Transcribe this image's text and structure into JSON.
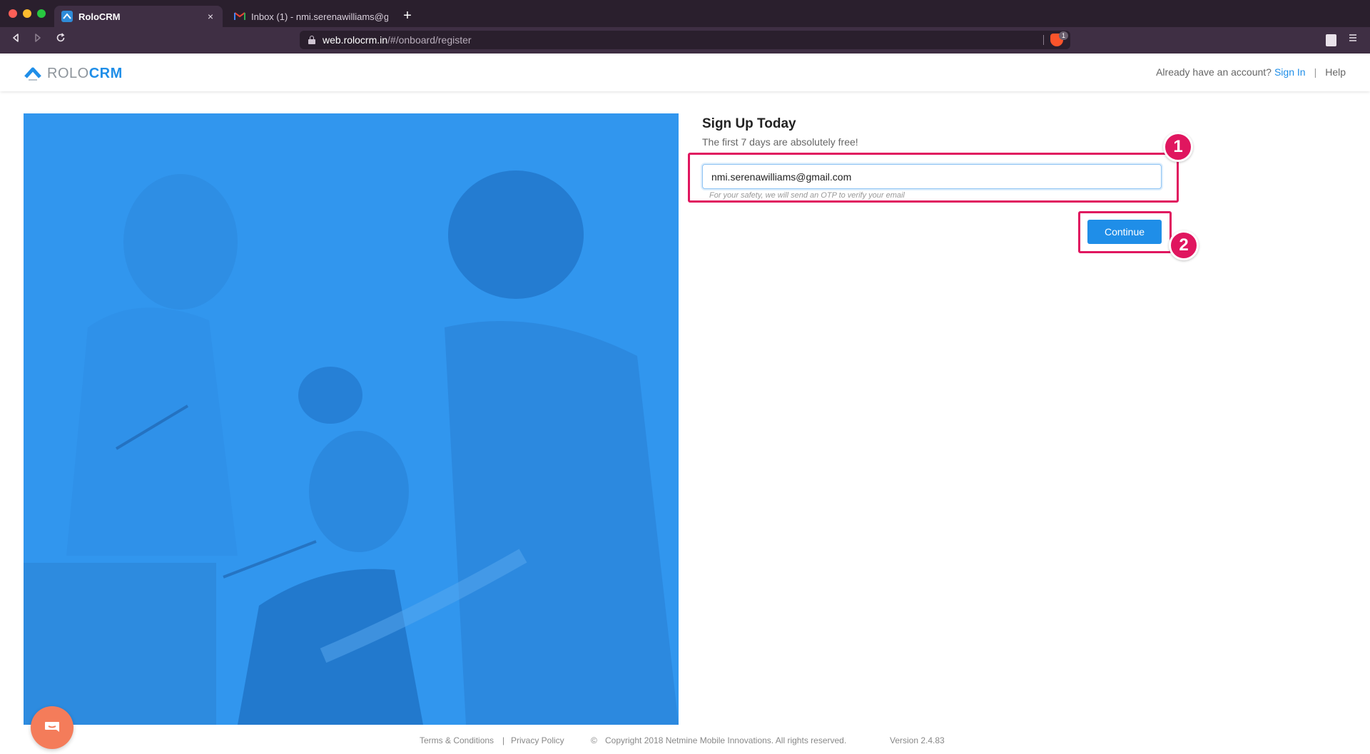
{
  "browser": {
    "tabs": [
      {
        "title": "RoloCRM",
        "active": true,
        "favicon": "rolocrm-favicon-icon",
        "close": "×"
      },
      {
        "title": "Inbox (1) - nmi.serenawilliams@gma",
        "active": false,
        "favicon": "gmail-icon"
      }
    ],
    "new_tab_label": "+",
    "url": {
      "host": "web.rolocrm.in",
      "path": "/#/onboard/register"
    },
    "brave_badge": "1"
  },
  "header": {
    "logo": {
      "part1": "ROLO",
      "part2": "CRM"
    },
    "account_question": "Already have an account?",
    "sign_in": "Sign In",
    "separator": "|",
    "help": "Help"
  },
  "signup": {
    "title": "Sign Up Today",
    "subtitle": "The first 7 days are absolutely free!",
    "email_value": "nmi.serenawilliams@gmail.com",
    "email_hint": "For your safety, we will send an OTP to verify your email",
    "continue_label": "Continue"
  },
  "annotations": [
    {
      "number": "1",
      "target": "email-field"
    },
    {
      "number": "2",
      "target": "continue-button"
    }
  ],
  "footer": {
    "terms": "Terms & Conditions",
    "separator": "|",
    "privacy": "Privacy Policy",
    "copyright_symbol": "©",
    "copyright": "Copyright 2018 Netmine Mobile Innovations. All rights reserved.",
    "version": "Version 2.4.83"
  },
  "colors": {
    "brand_blue": "#1f8ee8",
    "hero_blue": "#3196ee",
    "annotation_pink": "#e0165f",
    "chat_orange": "#f47c5a",
    "chrome_dark": "#2a1f2d"
  }
}
